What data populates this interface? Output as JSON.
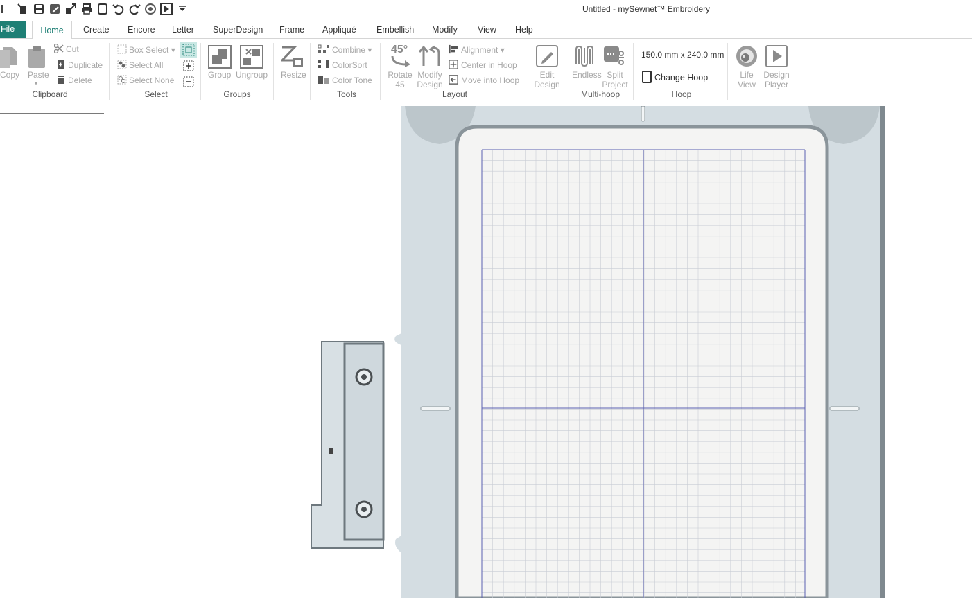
{
  "window": {
    "title": "Untitled -  mySewnet™ Embroidery"
  },
  "quick_access": [
    "app-icon",
    "new-icon",
    "save-icon",
    "save-as-icon",
    "export-icon",
    "print-icon",
    "hoop-icon",
    "undo-icon",
    "redo-icon",
    "life-view-icon",
    "play-icon",
    "customize-dropdown-icon"
  ],
  "tabs": [
    {
      "label": "File"
    },
    {
      "label": "Home"
    },
    {
      "label": "Create"
    },
    {
      "label": "Encore"
    },
    {
      "label": "Letter"
    },
    {
      "label": "SuperDesign"
    },
    {
      "label": "Frame"
    },
    {
      "label": "Appliqué"
    },
    {
      "label": "Embellish"
    },
    {
      "label": "Modify"
    },
    {
      "label": "View"
    },
    {
      "label": "Help"
    }
  ],
  "ribbon": {
    "clipboard": {
      "label": "Clipboard",
      "copy": "Copy",
      "paste": "Paste",
      "cut": "Cut",
      "duplicate": "Duplicate",
      "delete": "Delete"
    },
    "select": {
      "label": "Select",
      "box_select": "Box Select",
      "select_all": "Select All",
      "select_none": "Select None"
    },
    "groups": {
      "label": "Groups",
      "group": "Group",
      "ungroup": "Ungroup"
    },
    "resize": {
      "label": "Resize"
    },
    "tools": {
      "label": "Tools",
      "combine": "Combine",
      "colorsort": "ColorSort",
      "color_tone": "Color Tone"
    },
    "layout": {
      "label": "Layout",
      "rotate_1": "Rotate",
      "rotate_2": "45",
      "modify_1": "Modify",
      "modify_2": "Design",
      "alignment": "Alignment",
      "center_in_hoop": "Center in Hoop",
      "move_into_hoop": "Move into Hoop",
      "rotate_icon_text": "45°"
    },
    "edit": {
      "line1": "Edit",
      "line2": "Design"
    },
    "multihoop": {
      "label": "Multi-hoop",
      "endless": "Endless",
      "split_1": "Split",
      "split_2": "Project"
    },
    "hoop": {
      "label": "Hoop",
      "size": "150.0 mm x 240.0 mm",
      "change_hoop": "Change Hoop"
    },
    "life_view": {
      "line1": "Life",
      "line2": "View"
    },
    "design_player": {
      "line1": "Design",
      "line2": "Player"
    }
  },
  "colors": {
    "accent": "#1e7f75",
    "hoop_frame": "#d3dce1",
    "grid_line": "#c8ccd4",
    "axis_line": "#5a5fb0"
  }
}
